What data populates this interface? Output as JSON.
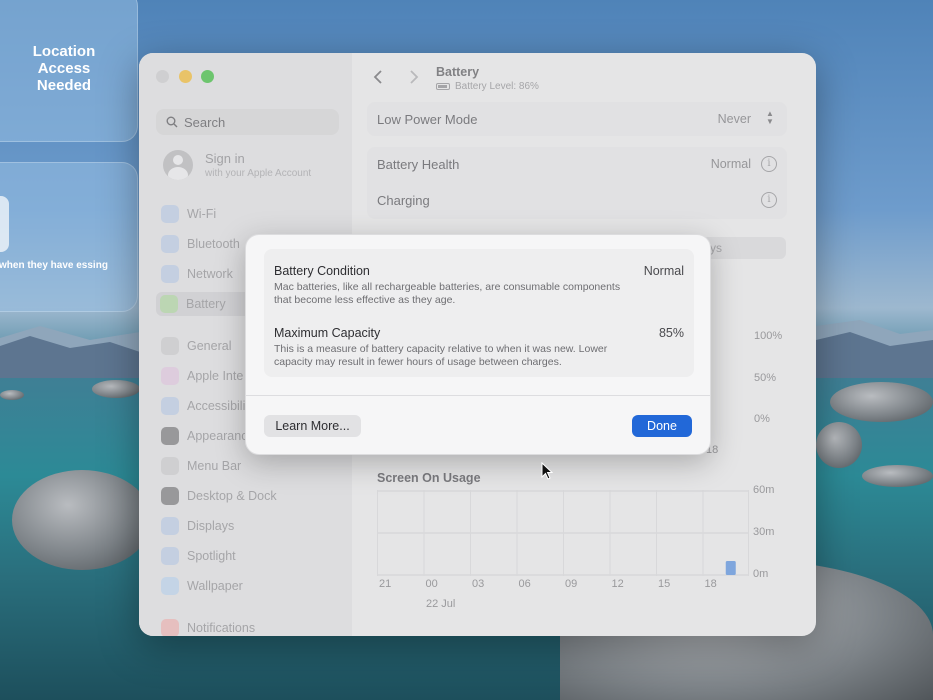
{
  "widgets": {
    "location": {
      "text": "Location Access Needed"
    },
    "second": {
      "text": "when they have essing"
    }
  },
  "window": {
    "title": "Battery",
    "subtitle": "Battery Level: 86%"
  },
  "sidebar": {
    "search_placeholder": "Search",
    "account": {
      "title": "Sign in",
      "subtitle": "with your Apple Account"
    },
    "items": [
      {
        "label": "Wi-Fi",
        "icon": "wifi-icon",
        "color": "#a8bde0"
      },
      {
        "label": "Bluetooth",
        "icon": "bluetooth-icon",
        "color": "#a8bde0"
      },
      {
        "label": "Network",
        "icon": "network-icon",
        "color": "#a8bde0"
      },
      {
        "label": "Battery",
        "icon": "battery-icon",
        "color": "#9fd28e"
      },
      {
        "label": "General",
        "icon": "gear-icon",
        "color": "#bdbdc0"
      },
      {
        "label": "Apple Inte",
        "icon": "apple-intelligence-icon",
        "color": "#d8b8d8"
      },
      {
        "label": "Accessibili",
        "icon": "accessibility-icon",
        "color": "#a8bde0"
      },
      {
        "label": "Appearanc",
        "icon": "appearance-icon",
        "color": "#555558"
      },
      {
        "label": "Menu Bar",
        "icon": "menu-bar-icon",
        "color": "#bdbdc0"
      },
      {
        "label": "Desktop & Dock",
        "icon": "desktop-dock-icon",
        "color": "#555558"
      },
      {
        "label": "Displays",
        "icon": "displays-icon",
        "color": "#a8bde0"
      },
      {
        "label": "Spotlight",
        "icon": "spotlight-icon",
        "color": "#a8bde0"
      },
      {
        "label": "Wallpaper",
        "icon": "wallpaper-icon",
        "color": "#a8c8e8"
      },
      {
        "label": "Notifications",
        "icon": "notifications-icon",
        "color": "#e8a0a0"
      }
    ]
  },
  "main": {
    "low_power": {
      "label": "Low Power Mode",
      "value": "Never"
    },
    "battery_health": {
      "label": "Battery Health",
      "value": "Normal"
    },
    "charging": {
      "label": "Charging"
    },
    "segment_fragment": "ys",
    "level_axis": [
      "100%",
      "50%",
      "0%"
    ],
    "level_x_fragment": "18",
    "screen_on": {
      "title": "Screen On Usage",
      "y_axis": [
        "60m",
        "30m",
        "0m"
      ],
      "x_axis": [
        "21",
        "00",
        "03",
        "06",
        "09",
        "12",
        "15",
        "18"
      ],
      "date_label": "22 Jul"
    }
  },
  "chart_data": {
    "type": "bar",
    "title": "Screen On Usage",
    "categories": [
      "21",
      "00",
      "03",
      "06",
      "09",
      "12",
      "15",
      "18"
    ],
    "ylim": [
      0,
      60
    ],
    "y_ticks": [
      "60m",
      "30m",
      "0m"
    ],
    "series": [
      {
        "values": [
          0,
          0,
          0,
          0,
          0,
          0,
          0,
          10
        ]
      }
    ],
    "bar_color": "#5b8fd8",
    "grid": true
  },
  "sheet": {
    "condition": {
      "title": "Battery Condition",
      "value": "Normal",
      "desc": "Mac batteries, like all rechargeable batteries, are consumable components that become less effective as they age."
    },
    "capacity": {
      "title": "Maximum Capacity",
      "value": "85%",
      "desc": "This is a measure of battery capacity relative to when it was new. Lower capacity may result in fewer hours of usage between charges."
    },
    "learn_more": "Learn More...",
    "done": "Done"
  }
}
